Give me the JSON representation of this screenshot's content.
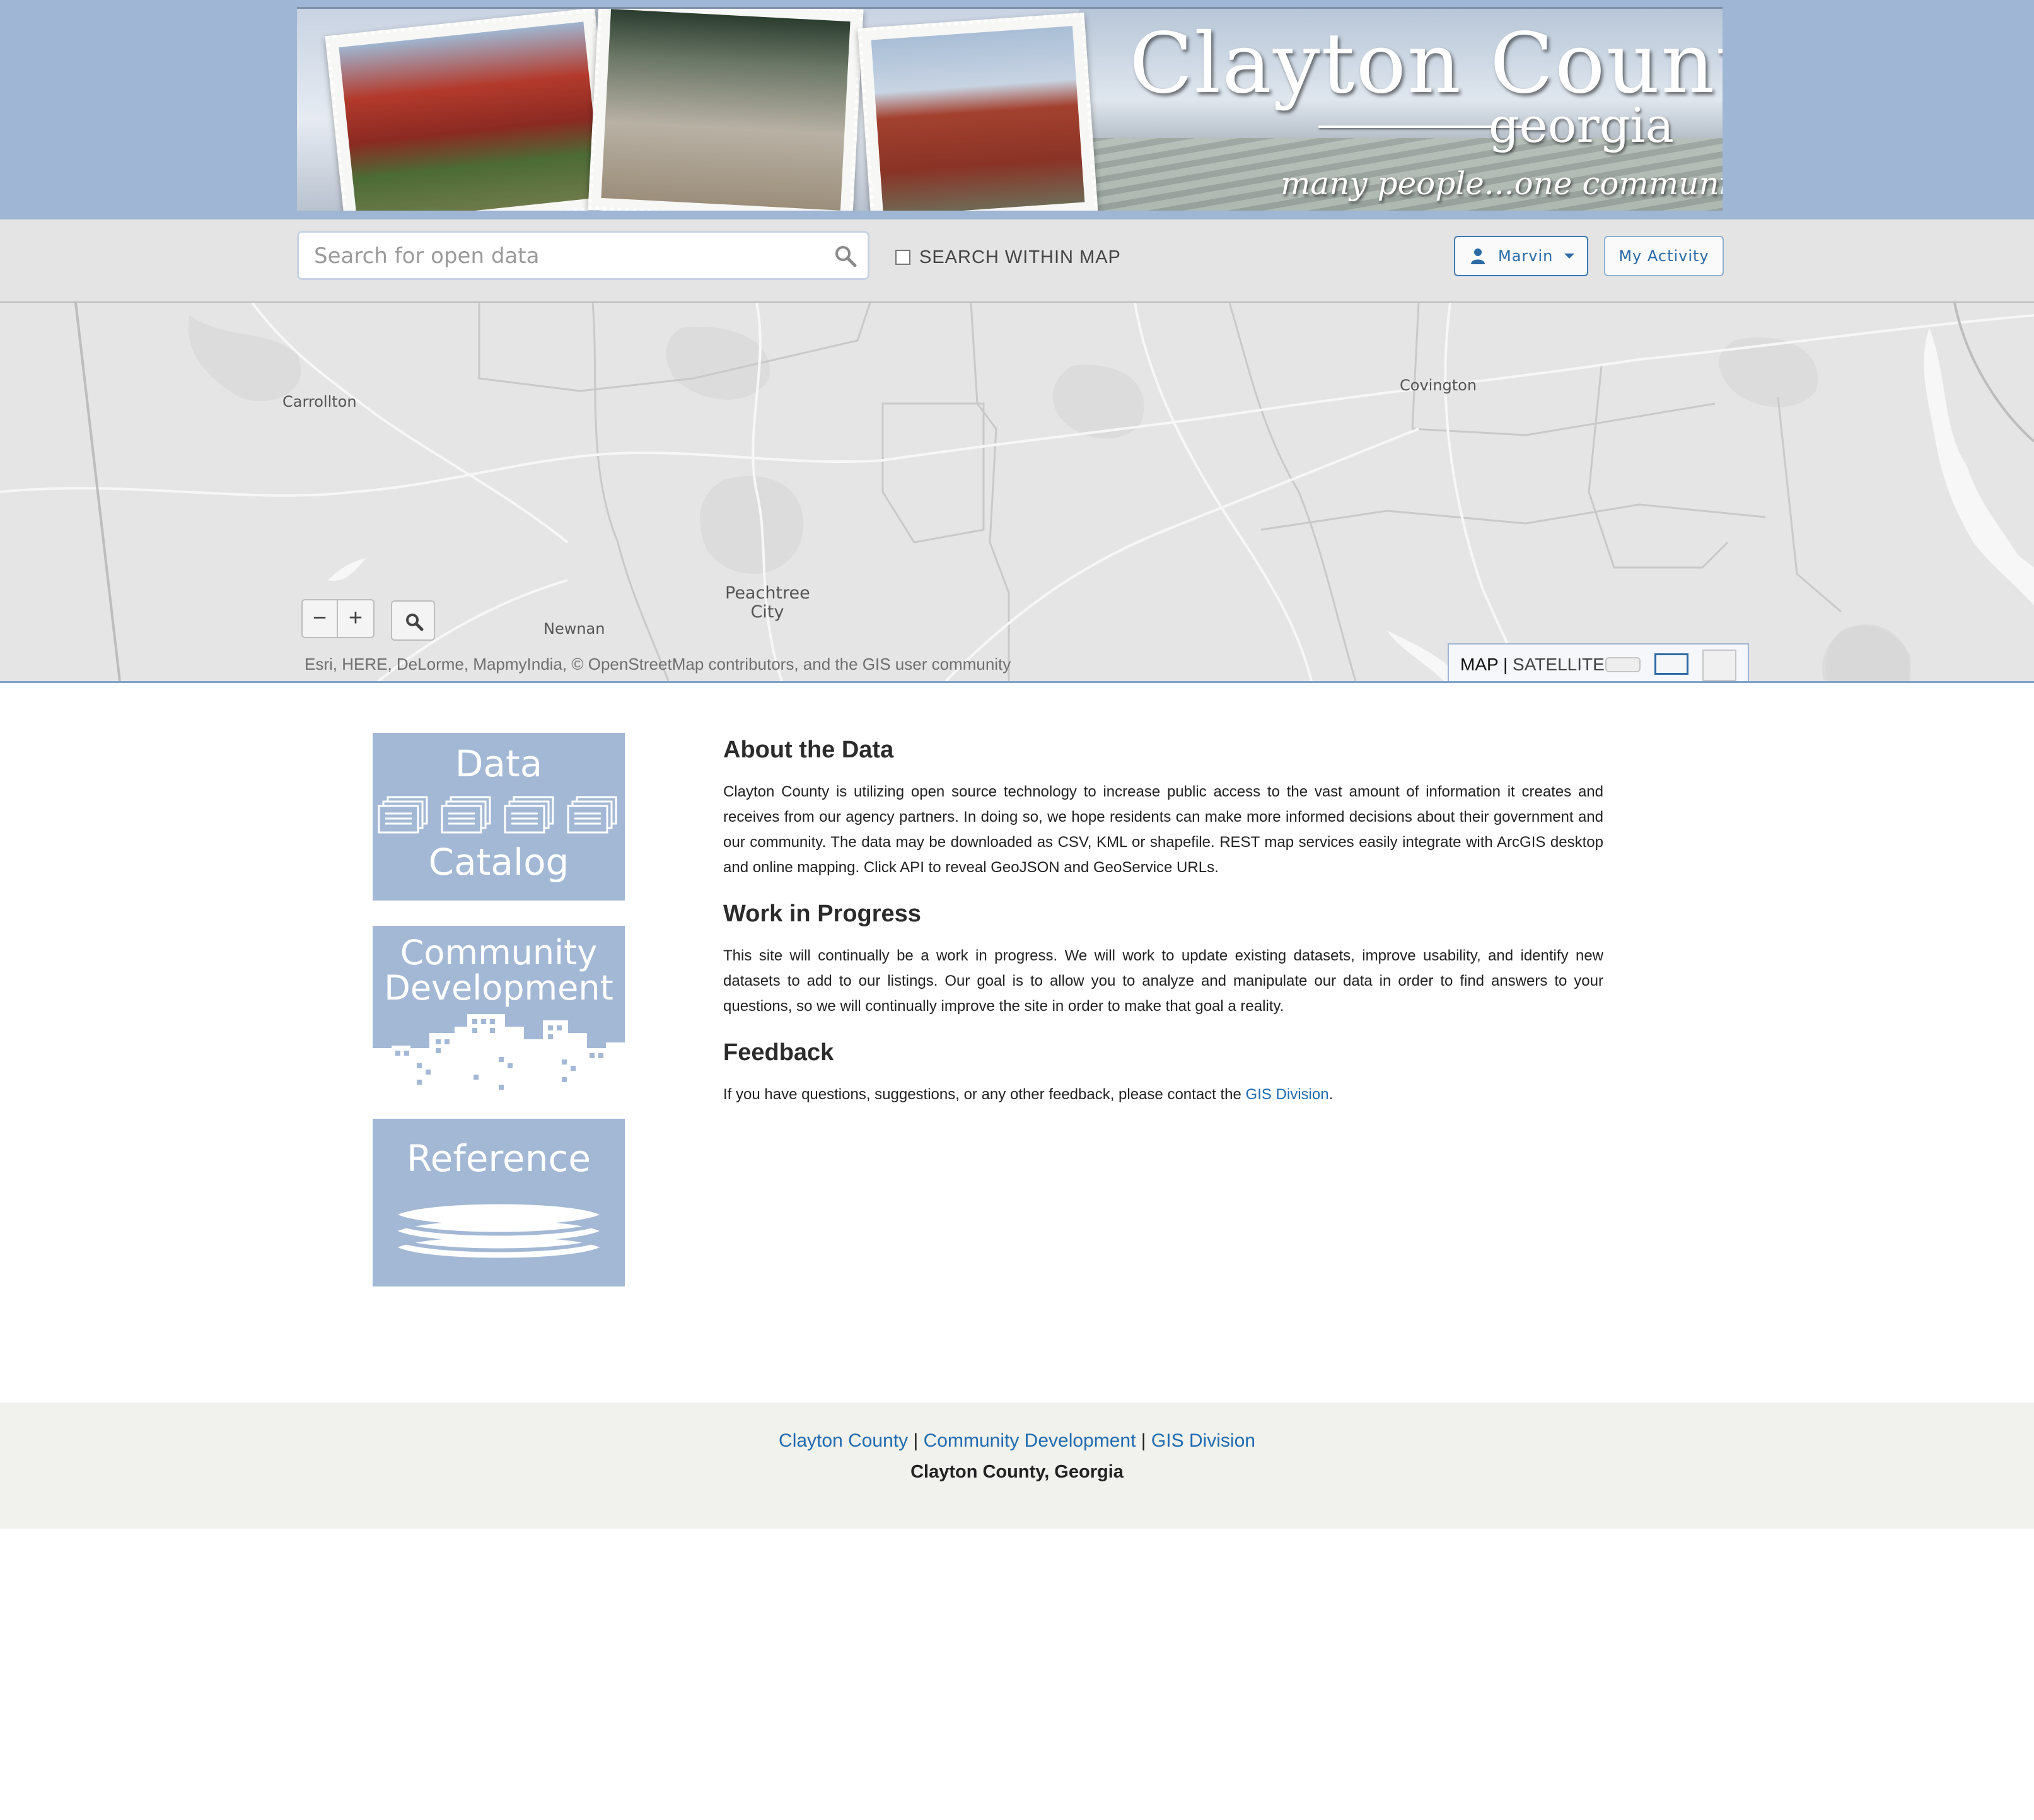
{
  "header": {
    "title": "Clayton County",
    "subtitle": "georgia",
    "tagline": "many people...one community"
  },
  "toolbar": {
    "search_placeholder": "Search for open data",
    "search_within_map_label": "SEARCH WITHIN MAP",
    "search_within_map_checked": false,
    "user_name": "Marvin",
    "my_activity_label": "My Activity"
  },
  "map": {
    "cities": {
      "carrollton": "Carrollton",
      "covington": "Covington",
      "peachtree_line1": "Peachtree",
      "peachtree_line2": "City",
      "newnan": "Newnan"
    },
    "zoom_out": "−",
    "zoom_in": "+",
    "attribution": "Esri, HERE, DeLorme, MapmyIndia, © OpenStreetMap contributors, and the GIS user community",
    "basemap": {
      "map_label": "MAP",
      "separator": "|",
      "satellite_label": "SATELLITE",
      "selected": "MAP"
    }
  },
  "tiles": {
    "data_catalog": {
      "line1": "Data",
      "line2": "Catalog"
    },
    "community_development": {
      "line1": "Community",
      "line2": "Development"
    },
    "reference": {
      "line1": "Reference"
    }
  },
  "content": {
    "about_heading": "About the Data",
    "about_text": "Clayton County is utilizing open source technology to increase public access to the vast amount of information it creates and receives from our agency partners. In doing so, we hope residents can make more informed decisions about their government and our community. The data may be downloaded as CSV, KML or shapefile. REST map services easily integrate with ArcGIS desktop and online mapping. Click API to reveal GeoJSON and GeoService URLs.",
    "work_heading": "Work in Progress",
    "work_text": "This site will continually be a work in progress. We will work to update existing datasets, improve usability, and identify new datasets to add to our listings. Our goal is to allow you to analyze and manipulate our data in order to find answers to your questions, so we will continually improve the site in order to make that goal a reality.",
    "feedback_heading": "Feedback",
    "feedback_text": "If you have questions, suggestions, or any other feedback, please contact the ",
    "feedback_link": "GIS Division",
    "feedback_end": "."
  },
  "footer": {
    "link1": "Clayton County",
    "link2": "Community Development",
    "link3": "GIS Division",
    "separator": "|",
    "title": "Clayton County, Georgia"
  },
  "colors": {
    "header_band": "#9fb6d4",
    "tile_blue": "#a3b8d5",
    "link_blue": "#1f6bb0",
    "footer_bg": "#f1f1ed"
  }
}
